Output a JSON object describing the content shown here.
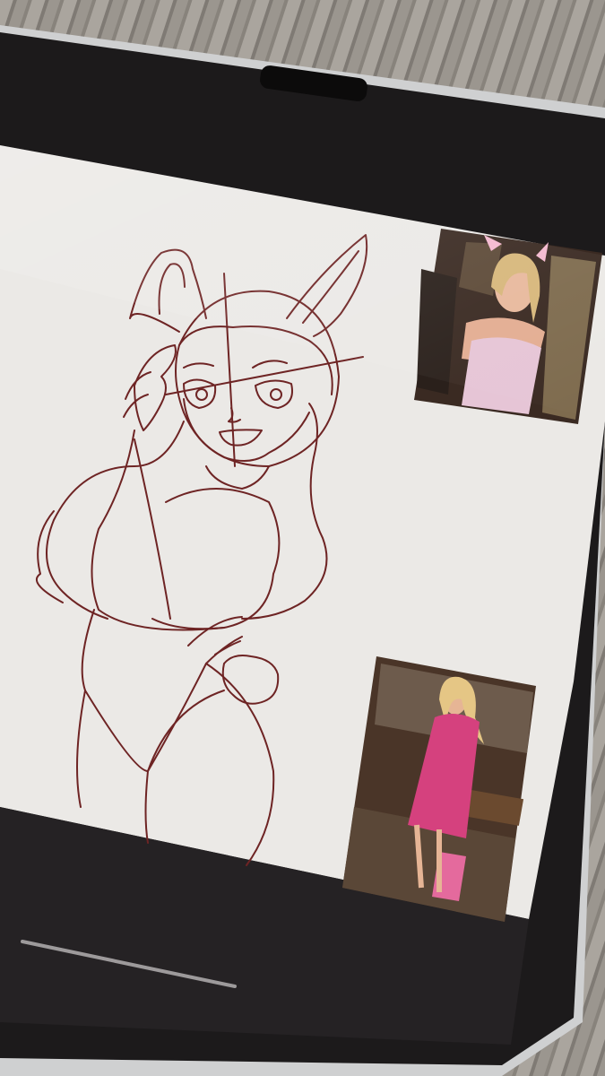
{
  "scene": {
    "subject": "tablet-photo",
    "accent_colors": {
      "couch": "#9a958e",
      "tablet_frame": "#1a1819",
      "canvas": "#ebe9e6",
      "sketch_line": "#6e2424",
      "pink_outfit": "#d5417e"
    }
  },
  "canvas": {
    "sketch": {
      "subject": "bunny-girl-line-sketch",
      "stroke_color": "#6e2424"
    },
    "references": [
      {
        "id": "reference-photo-top",
        "subject": "woman-in-bunny-costume"
      },
      {
        "id": "reference-photo-bottom",
        "subject": "woman-in-pink-dress-in-courtroom"
      }
    ]
  },
  "device": {
    "home_indicator": true,
    "camera_notch": true
  }
}
